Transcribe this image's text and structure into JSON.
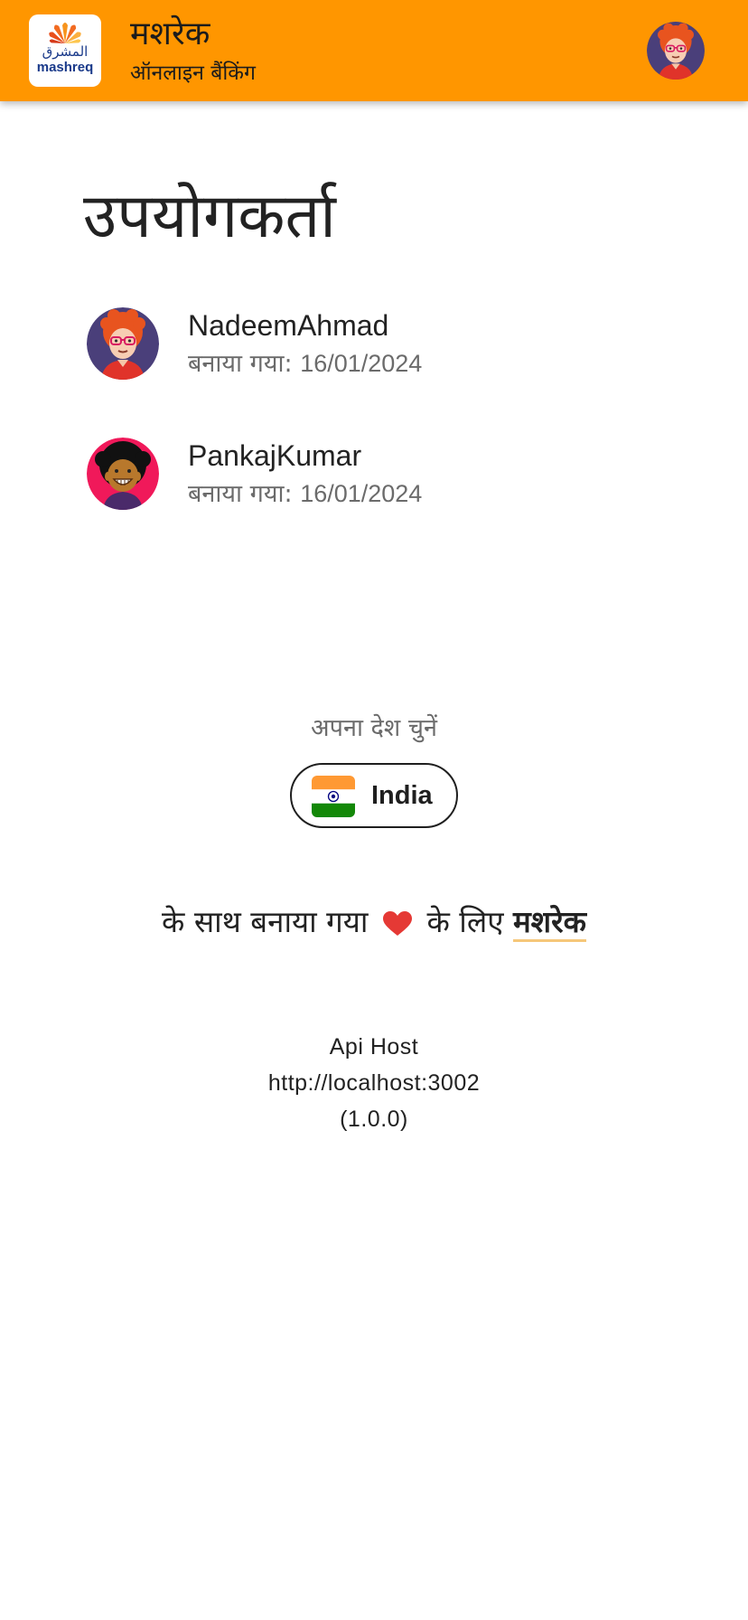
{
  "appbar": {
    "title": "मशरेक",
    "subtitle": "ऑनलाइन बैंकिंग",
    "logo": {
      "arabic_text": "المشرق",
      "latin_text": "mashreq"
    },
    "profile_icon": "user-avatar-icon"
  },
  "users": {
    "heading": "उपयोगकर्ता",
    "items": [
      {
        "name": "NadeemAhmad",
        "created_label": "बनाया गया:",
        "created_date": "16/01/2024",
        "avatar_icon": "avatar-red-curly-hair-glasses"
      },
      {
        "name": "PankajKumar",
        "created_label": "बनाया गया:",
        "created_date": "16/01/2024",
        "avatar_icon": "avatar-afro-smiling"
      }
    ]
  },
  "country": {
    "label": "अपना देश चुनें",
    "selected": "India",
    "flag_icon": "india-flag-icon"
  },
  "made_with": {
    "prefix": "के साथ बनाया गया",
    "heart_icon": "heart-icon",
    "middle": "के लिए",
    "brand": "मशरेक"
  },
  "api": {
    "label": "Api Host",
    "host": "http://localhost:3002",
    "version": "(1.0.0)"
  },
  "colors": {
    "appbar_bg": "#ff9600",
    "heart": "#e53935",
    "brand_underline": "#f6c77a",
    "muted_text": "#6b6b6b"
  }
}
